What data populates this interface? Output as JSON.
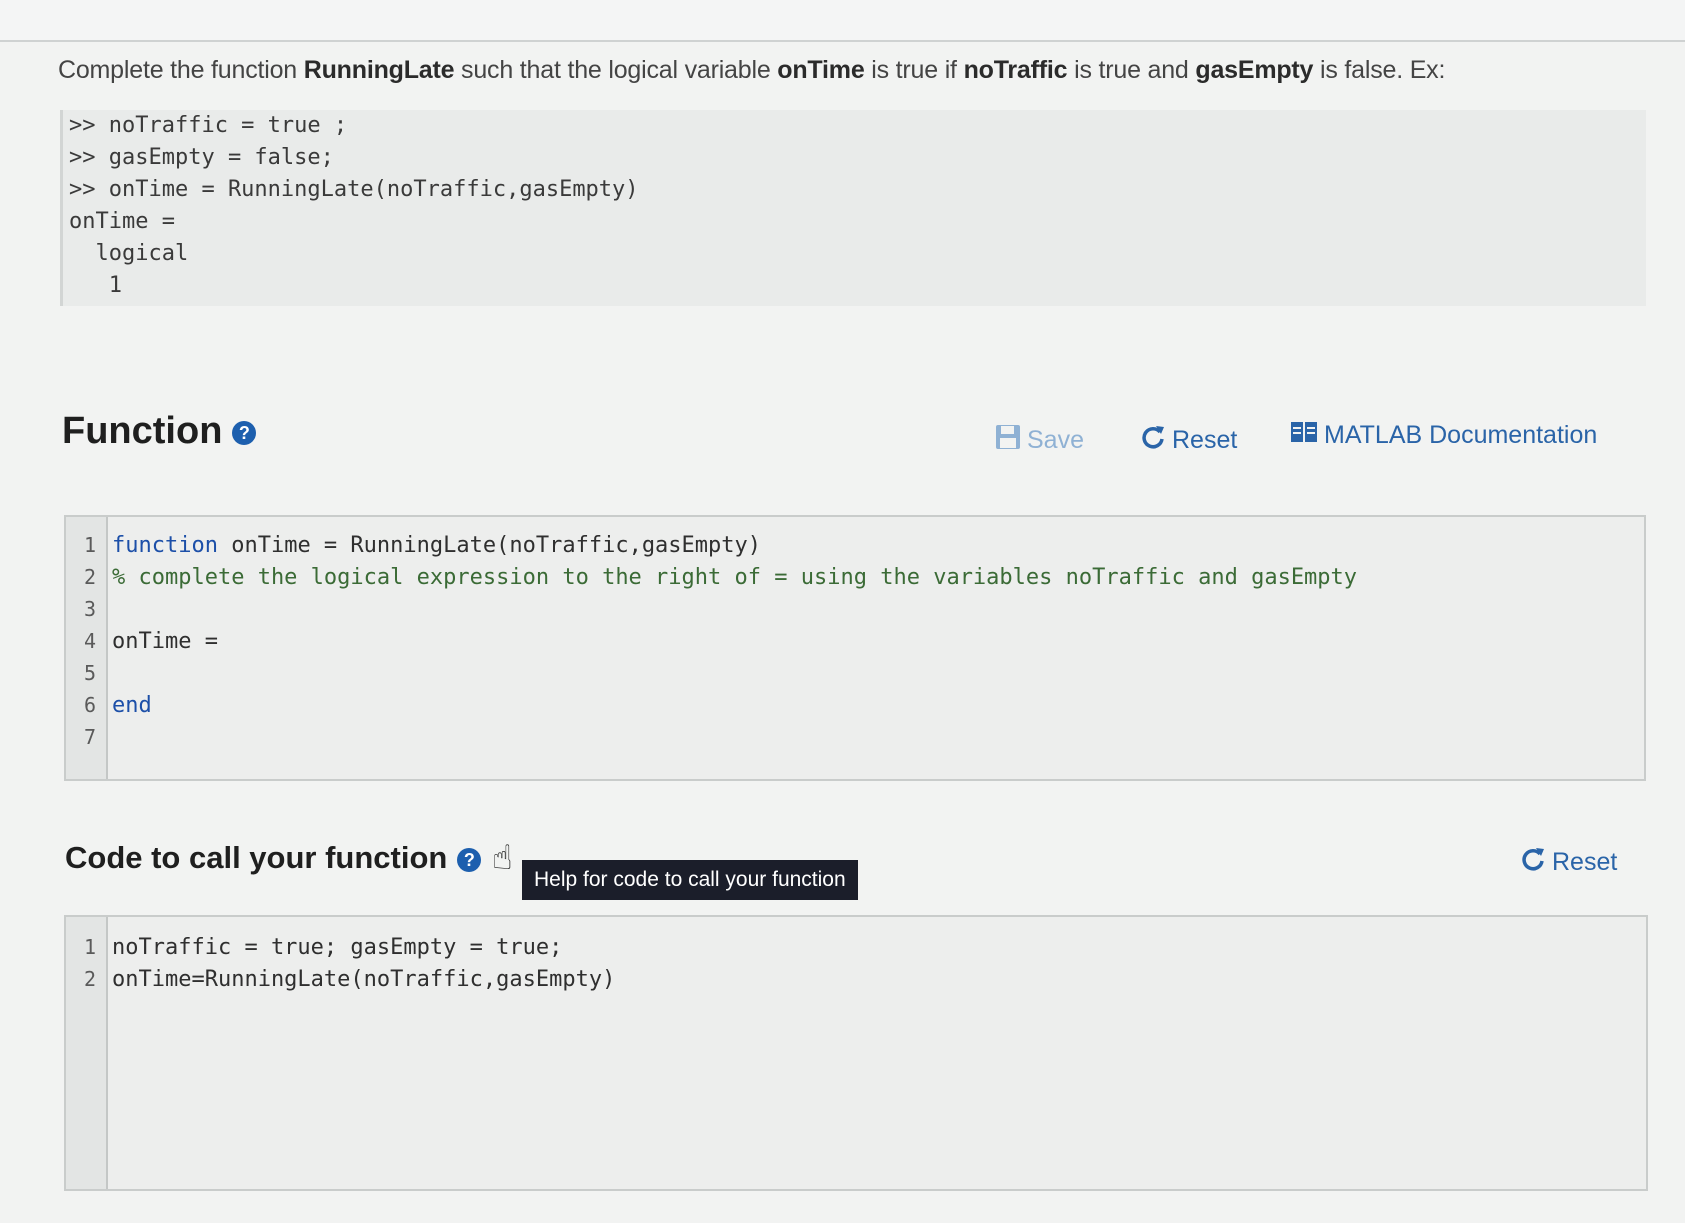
{
  "problem": {
    "prefix": "Complete the function ",
    "fn_name": "RunningLate",
    "mid1": " such that the logical variable ",
    "var_ontime": "onTime",
    "mid2": " is true if ",
    "var_notraffic": "noTraffic",
    "mid3": " is true and ",
    "var_gasempty": "gasEmpty",
    "suffix": " is false.  Ex:"
  },
  "example_lines": [
    ">> noTraffic = true ;",
    ">> gasEmpty = false;",
    ">> onTime = RunningLate(noTraffic,gasEmpty)",
    "onTime =",
    "  logical",
    "   1"
  ],
  "function_section": {
    "title": "Function",
    "help_icon_glyph": "?",
    "save_label": "Save",
    "reset_label": "Reset",
    "docs_label": "MATLAB Documentation"
  },
  "function_editor": {
    "line_numbers": [
      "1",
      "2",
      "3",
      "4",
      "5",
      "6",
      "7"
    ],
    "line1_kw": "function",
    "line1_rest": " onTime = RunningLate(noTraffic,gasEmpty)",
    "line2": "% complete the logical expression to the right of = using the variables noTraffic and gasEmpty",
    "line3": "",
    "line4": "onTime =",
    "line5": "",
    "line6": "end",
    "line7": ""
  },
  "call_section": {
    "title": "Code to call your function",
    "help_icon_glyph": "?",
    "tooltip": "Help for code to call your function",
    "reset_label": "Reset"
  },
  "call_editor": {
    "line_numbers": [
      "1",
      "2"
    ],
    "line1": "noTraffic = true; gasEmpty = true;",
    "line2": "onTime=RunningLate(noTraffic,gasEmpty)"
  },
  "colors": {
    "accent": "#2a64a8",
    "help_icon": "#1d5fae",
    "tooltip_bg": "#1b1e2a"
  }
}
